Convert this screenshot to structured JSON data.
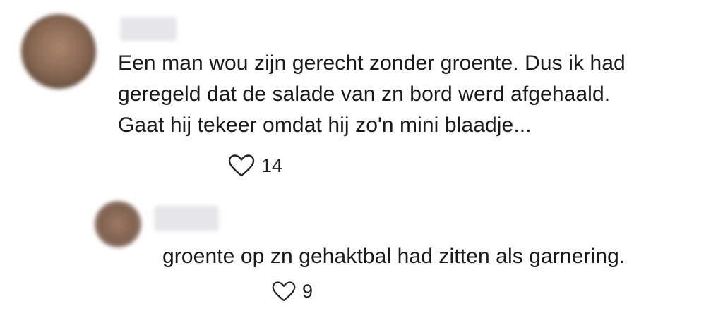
{
  "comment": {
    "avatar_icon": "user-avatar-blurred",
    "author": "",
    "text": "Een man wou zijn gerecht zonder groente. Dus ik had\ngeregeld dat de salade van zn bord werd afgehaald.\nGaat hij tekeer omdat hij zo'n mini blaadje...",
    "like_icon": "heart-outline-icon",
    "like_count": "14"
  },
  "reply": {
    "avatar_icon": "user-avatar-blurred",
    "author": "",
    "text": "groente op zn gehaktbal had zitten als garnering.",
    "like_icon": "heart-outline-icon",
    "like_count": "9"
  }
}
